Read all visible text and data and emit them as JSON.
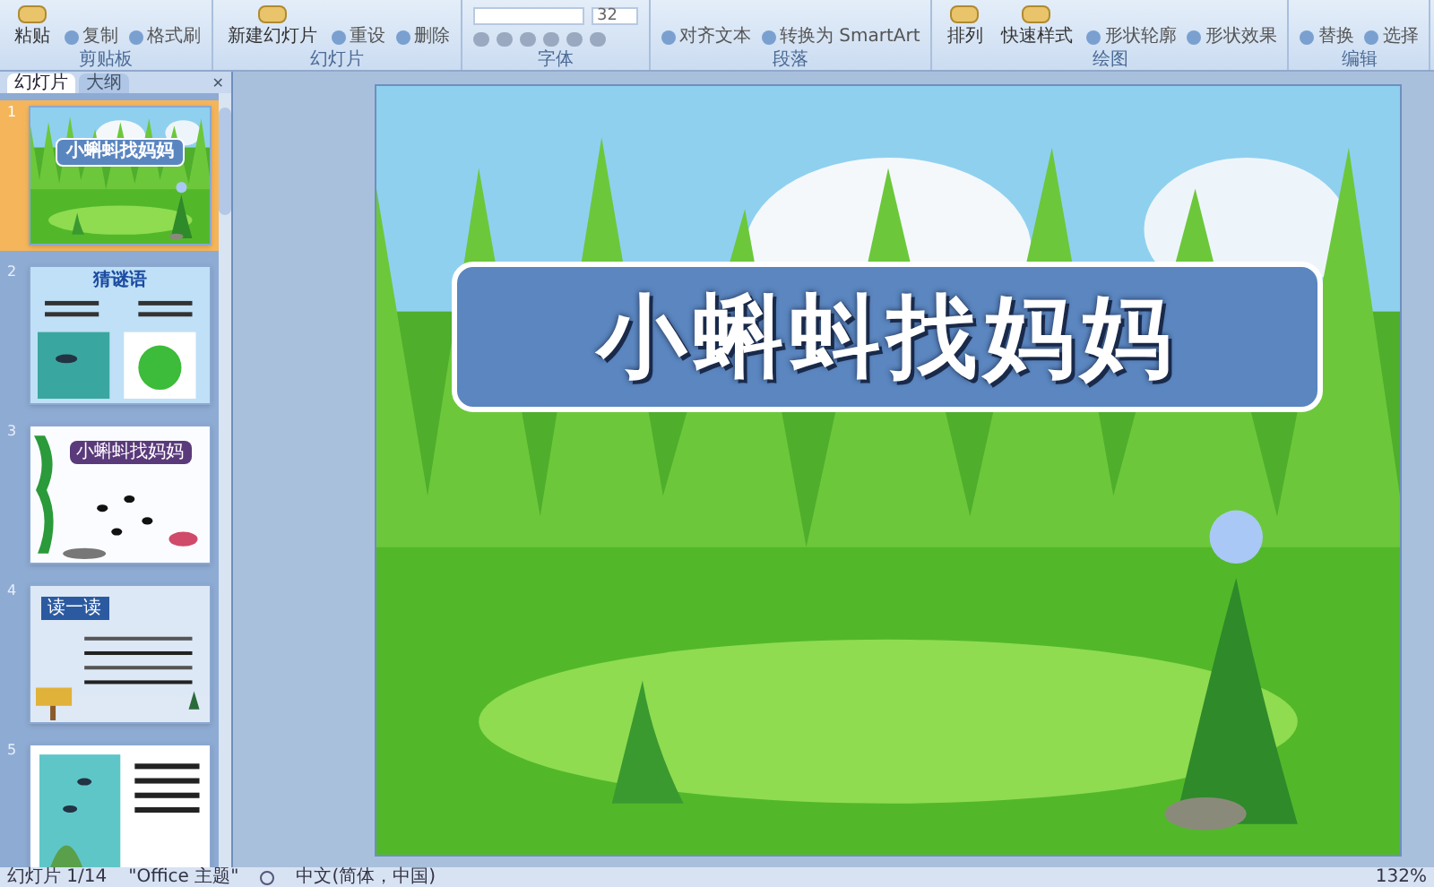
{
  "ribbon": {
    "groups": [
      {
        "label": "剪贴板",
        "items": [
          {
            "kind": "big",
            "label": "粘贴"
          },
          {
            "kind": "small",
            "label": "复制"
          },
          {
            "kind": "small",
            "label": "格式刷"
          }
        ]
      },
      {
        "label": "幻灯片",
        "items": [
          {
            "kind": "big",
            "label": "新建幻灯片"
          },
          {
            "kind": "small",
            "label": "重设"
          },
          {
            "kind": "small",
            "label": "删除"
          }
        ]
      },
      {
        "label": "字体",
        "items": [
          {
            "kind": "field",
            "label": "32"
          }
        ]
      },
      {
        "label": "段落",
        "items": [
          {
            "kind": "small",
            "label": "对齐文本"
          },
          {
            "kind": "small",
            "label": "转换为 SmartArt"
          }
        ]
      },
      {
        "label": "绘图",
        "items": [
          {
            "kind": "big",
            "label": "排列"
          },
          {
            "kind": "big",
            "label": "快速样式"
          },
          {
            "kind": "small",
            "label": "形状轮廓"
          },
          {
            "kind": "small",
            "label": "形状效果"
          }
        ]
      },
      {
        "label": "编辑",
        "items": [
          {
            "kind": "small",
            "label": "替换"
          },
          {
            "kind": "small",
            "label": "选择"
          }
        ]
      }
    ]
  },
  "slide_panel": {
    "close": "✕",
    "tabs": [
      {
        "label": "幻灯片",
        "selected": true
      },
      {
        "label": "大纲",
        "selected": false
      }
    ],
    "thumbnails": [
      {
        "number": "1",
        "selected": true,
        "kind": "grass",
        "title": "小蝌蚪找妈妈"
      },
      {
        "number": "2",
        "selected": false,
        "kind": "riddle",
        "title": "猜谜语"
      },
      {
        "number": "3",
        "selected": false,
        "kind": "band",
        "title": "小蝌蚪找妈妈"
      },
      {
        "number": "4",
        "selected": false,
        "kind": "reading",
        "title": "读一读"
      },
      {
        "number": "5",
        "selected": false,
        "kind": "story"
      }
    ]
  },
  "slide": {
    "title": "小蝌蚪找妈妈"
  },
  "status_bar": {
    "slide": "幻灯片 1/14",
    "theme": "\"Office 主题\"",
    "language": "中文(简体，中国)",
    "zoom": "132%"
  }
}
